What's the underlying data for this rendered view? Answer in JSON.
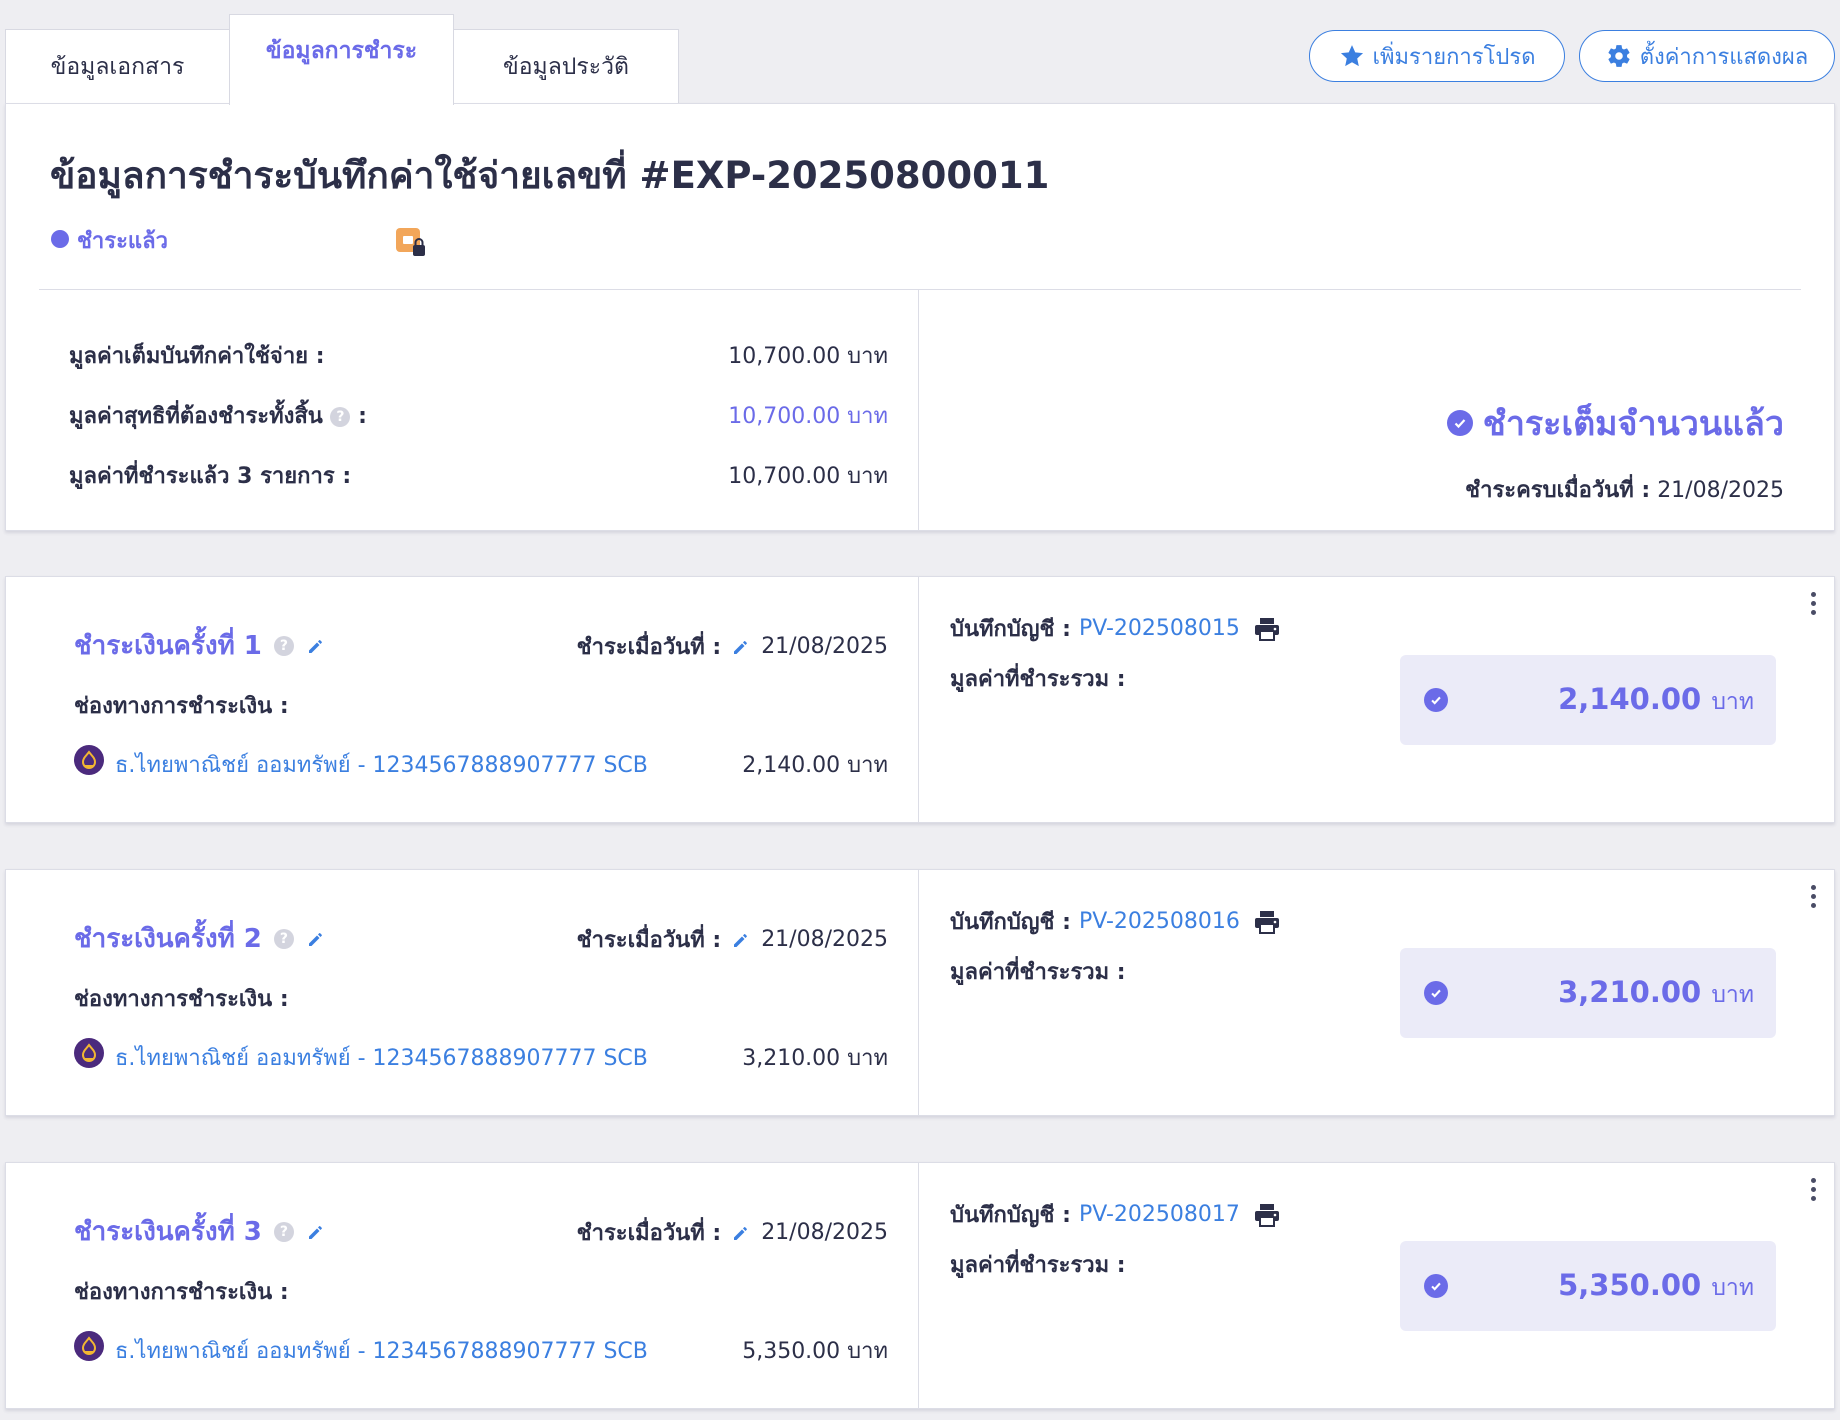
{
  "tabs": [
    {
      "label": "ข้อมูลเอกสาร",
      "active": false
    },
    {
      "label": "ข้อมูลการชำระ",
      "active": true
    },
    {
      "label": "ข้อมูลประวัติ",
      "active": false
    }
  ],
  "toolbar": {
    "favorite_label": "เพิ่มรายการโปรด",
    "settings_label": "ตั้งค่าการแสดงผล"
  },
  "summary": {
    "title": "ข้อมูลการชำระบันทึกค่าใช้จ่ายเลขที่ #EXP-20250800011",
    "status": "ชำระแล้ว",
    "rows": [
      {
        "label": "มูลค่าเต็มบันทึกค่าใช้จ่าย :",
        "value": "10,700.00 บาท"
      },
      {
        "label": "มูลค่าสุทธิที่ต้องชำระทั้งสิ้น",
        "label_suffix": ":",
        "value": "10,700.00 บาท"
      },
      {
        "label": "มูลค่าที่ชำระแล้ว 3 รายการ :",
        "value": "10,700.00 บาท"
      }
    ],
    "full_paid_label": "ชำระเต็มจำนวนแล้ว",
    "completed_label": "ชำระครบเมื่อวันที่ :",
    "completed_date": "21/08/2025"
  },
  "payments": [
    {
      "title": "ชำระเงินครั้งที่ 1",
      "paid_on_label": "ชำระเมื่อวันที่ :",
      "paid_on": "21/08/2025",
      "channel_label": "ช่องทางการชำระเงิน :",
      "bank": "ธ.ไทยพาณิชย์ ออมทรัพย์ - 1234567888907777 SCB",
      "amount": "2,140.00 บาท",
      "journal_label": "บันทึกบัญชี :",
      "journal_no": "PV-202508015",
      "total_label": "มูลค่าที่ชำระรวม :",
      "total": "2,140.00",
      "currency": "บาท"
    },
    {
      "title": "ชำระเงินครั้งที่ 2",
      "paid_on_label": "ชำระเมื่อวันที่ :",
      "paid_on": "21/08/2025",
      "channel_label": "ช่องทางการชำระเงิน :",
      "bank": "ธ.ไทยพาณิชย์ ออมทรัพย์ - 1234567888907777 SCB",
      "amount": "3,210.00 บาท",
      "journal_label": "บันทึกบัญชี :",
      "journal_no": "PV-202508016",
      "total_label": "มูลค่าที่ชำระรวม :",
      "total": "3,210.00",
      "currency": "บาท"
    },
    {
      "title": "ชำระเงินครั้งที่ 3",
      "paid_on_label": "ชำระเมื่อวันที่ :",
      "paid_on": "21/08/2025",
      "channel_label": "ช่องทางการชำระเงิน :",
      "bank": "ธ.ไทยพาณิชย์ ออมทรัพย์ - 1234567888907777 SCB",
      "amount": "5,350.00 บาท",
      "journal_label": "บันทึกบัญชี :",
      "journal_no": "PV-202508017",
      "total_label": "มูลค่าที่ชำระรวม :",
      "total": "5,350.00",
      "currency": "บาท"
    }
  ],
  "icons": {
    "favorite": "star-icon",
    "settings": "gear-icon",
    "lock": "lock-icon",
    "help": "help-icon",
    "edit": "pencil-icon",
    "print": "printer-icon",
    "check": "check-circle-icon",
    "bank": "scb-bank-icon",
    "more": "kebab-menu-icon"
  },
  "colors": {
    "accent": "#6b6be8",
    "link": "#3b7fe0",
    "text": "#2c2f48",
    "background": "#eeeef2",
    "total_box": "#ebebf8"
  }
}
